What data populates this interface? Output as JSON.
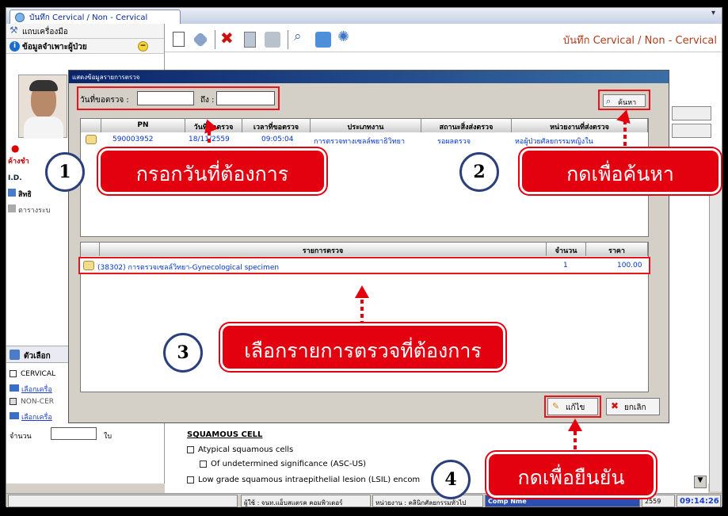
{
  "tab_title": "บันทึก Cervical / Non - Cervical",
  "main_title": "บันทึก Cervical / Non - Cervical",
  "left_panel": {
    "tools_label": "แถบเครื่องมือ",
    "patient_info_label": "ข้อมูลจำเพาะผู้ป่วย",
    "patient_status": "ค้างชำ",
    "id_label": "I.D.",
    "rights_label": "สิทธิ",
    "schedule_label": "ตารางระบ",
    "options_label": "ตัวเลือก",
    "cervical_label": "CERVICAL",
    "select_printer_1": "เลือกเครื่อ",
    "non_cervical_label": "NON-CER",
    "select_printer_2": "เลือกเครื่อ",
    "quantity_label": "จำนวน",
    "quantity_unit": "ใบ"
  },
  "dialog": {
    "title": "แสดงข้อมูลรายการตรวจ",
    "date_from_label": "วันที่ขอตรวจ :",
    "date_from_value": "",
    "date_to_label": "ถึง :",
    "date_to_value": "",
    "search_button": "ค้นหา",
    "request_table": {
      "headers": [
        "PN",
        "วันที่ขอตรวจ",
        "เวลาที่ขอตรวจ",
        "ประเภทงาน",
        "สถานะสิ่งส่งตรวจ",
        "หน่วยงานที่ส่งตรวจ"
      ],
      "rows": [
        [
          "590003952",
          "18/11/2559",
          "09:05:04",
          "การตรวจทางเซลล์พยาธิวิทยา",
          "รอผลตรวจ",
          "หอผู้ป่วยศัลยกรรมหญิงใน"
        ]
      ]
    },
    "items_table": {
      "headers": [
        "รายการตรวจ",
        "จำนวน",
        "ราคา"
      ],
      "rows": [
        [
          "(38302) การตรวจเซลล์วิทยา-Gynecological specimen",
          "1",
          "100.00"
        ]
      ]
    },
    "edit_button": "แก้ไข",
    "cancel_button": "ยกเลิก"
  },
  "form": {
    "section_title": "SQUAMOUS CELL",
    "option_1": "Atypical squamous cells",
    "option_2": "Of undetermined significance (ASC-US)",
    "option_3": "Low grade squamous intraepithelial lesion (LSIL) encom"
  },
  "status_bar": {
    "user": "ผู้ใช้ : จนท.แอ็บสแตรค คอมพิวเตอร์",
    "department": "หน่วยงาน : คลินิกศัลยกรรมทั่วไป",
    "comp": "Comp Nme",
    "date": "2559",
    "time": "09:14:26"
  },
  "annotations": {
    "step_1_number": "1",
    "step_1_text": "กรอกวันที่ต้องการ",
    "step_2_number": "2",
    "step_2_text": "กดเพื่อค้นหา",
    "step_3_number": "3",
    "step_3_text": "เลือกรายการตรวจที่ต้องการ",
    "step_4_number": "4",
    "step_4_text": "กดเพื่อยืนยัน",
    "accent_color": "#e3000f"
  }
}
